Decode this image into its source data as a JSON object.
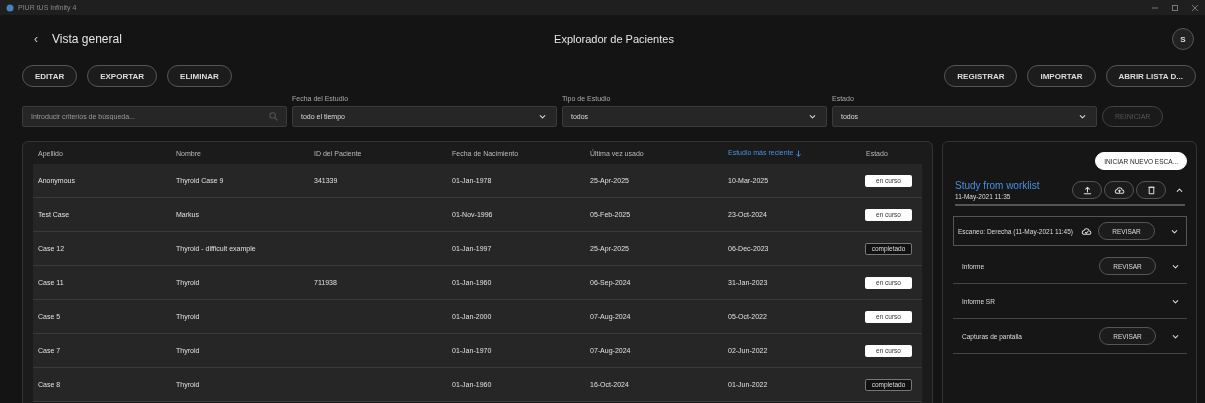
{
  "window": {
    "title": "PIUR tUS Infinity 4"
  },
  "header": {
    "back": "‹",
    "back_label": "Vista general",
    "title": "Explorador de Pacientes",
    "avatar": "S"
  },
  "actions_left": [
    "EDITAR",
    "EXPORTAR",
    "ELIMINAR"
  ],
  "actions_right": [
    "REGISTRAR",
    "IMPORTAR",
    "ABRIR LISTA D..."
  ],
  "search": {
    "placeholder": "Introducir criterios de búsqueda..."
  },
  "filters": [
    {
      "label": "Fecha del Estudio",
      "value": "todo el tiempo"
    },
    {
      "label": "Tipo de Estudio",
      "value": "todos"
    },
    {
      "label": "Estado",
      "value": "todos"
    }
  ],
  "reset_button": {
    "label": "REINICIAR",
    "disabled": true
  },
  "table": {
    "columns": [
      {
        "label": "Apellido",
        "sorted": false
      },
      {
        "label": "Nombre",
        "sorted": false
      },
      {
        "label": "ID del Paciente",
        "sorted": false
      },
      {
        "label": "Fecha de Nacimiento",
        "sorted": false
      },
      {
        "label": "Última vez usado",
        "sorted": false
      },
      {
        "label": "Estudio más reciente",
        "sorted": true
      },
      {
        "label": "Estado",
        "sorted": false
      }
    ],
    "rows": [
      {
        "cells": [
          "Anonymous",
          "Thyroid Case 9",
          "341339",
          "01-Jan-1978",
          "25-Apr-2025",
          "10-Mar-2025"
        ],
        "status": "en curso",
        "kind": "active"
      },
      {
        "cells": [
          "Test Case",
          "Markus",
          "",
          "01-Nov-1996",
          "05-Feb-2025",
          "23-Oct-2024"
        ],
        "status": "en curso",
        "kind": "active"
      },
      {
        "cells": [
          "Case 12",
          "Thyroid - difficult example",
          "",
          "01-Jan-1997",
          "25-Apr-2025",
          "06-Dec-2023"
        ],
        "status": "completado",
        "kind": "done"
      },
      {
        "cells": [
          "Case 11",
          "Thyroid",
          "711938",
          "01-Jan-1960",
          "06-Sep-2024",
          "31-Jan-2023"
        ],
        "status": "en curso",
        "kind": "active"
      },
      {
        "cells": [
          "Case 5",
          "Thyroid",
          "",
          "01-Jan-2000",
          "07-Aug-2024",
          "05-Oct-2022"
        ],
        "status": "en curso",
        "kind": "active"
      },
      {
        "cells": [
          "Case 7",
          "Thyroid",
          "",
          "01-Jan-1970",
          "07-Aug-2024",
          "02-Jun-2022"
        ],
        "status": "en curso",
        "kind": "active"
      },
      {
        "cells": [
          "Case 8",
          "Thyroid",
          "",
          "01-Jan-1960",
          "16-Oct-2024",
          "01-Jun-2022"
        ],
        "status": "completado",
        "kind": "done"
      }
    ]
  },
  "study_panel": {
    "new_scan_button": "INICIAR NUEVO ESCA...",
    "study_title": "Study from worklist",
    "study_date": "11-May-2021 11:35",
    "expanded": true,
    "items": [
      {
        "kind": "scan",
        "label": "Escaneo: Derecha (11-May-2021 11:45)",
        "button": "REVISAR"
      },
      {
        "kind": "section",
        "label": "Informe",
        "button": "REVISAR"
      },
      {
        "kind": "section",
        "label": "Informe SR"
      },
      {
        "kind": "section",
        "label": "Capturas de pantalla",
        "button": "REVISAR"
      }
    ]
  }
}
